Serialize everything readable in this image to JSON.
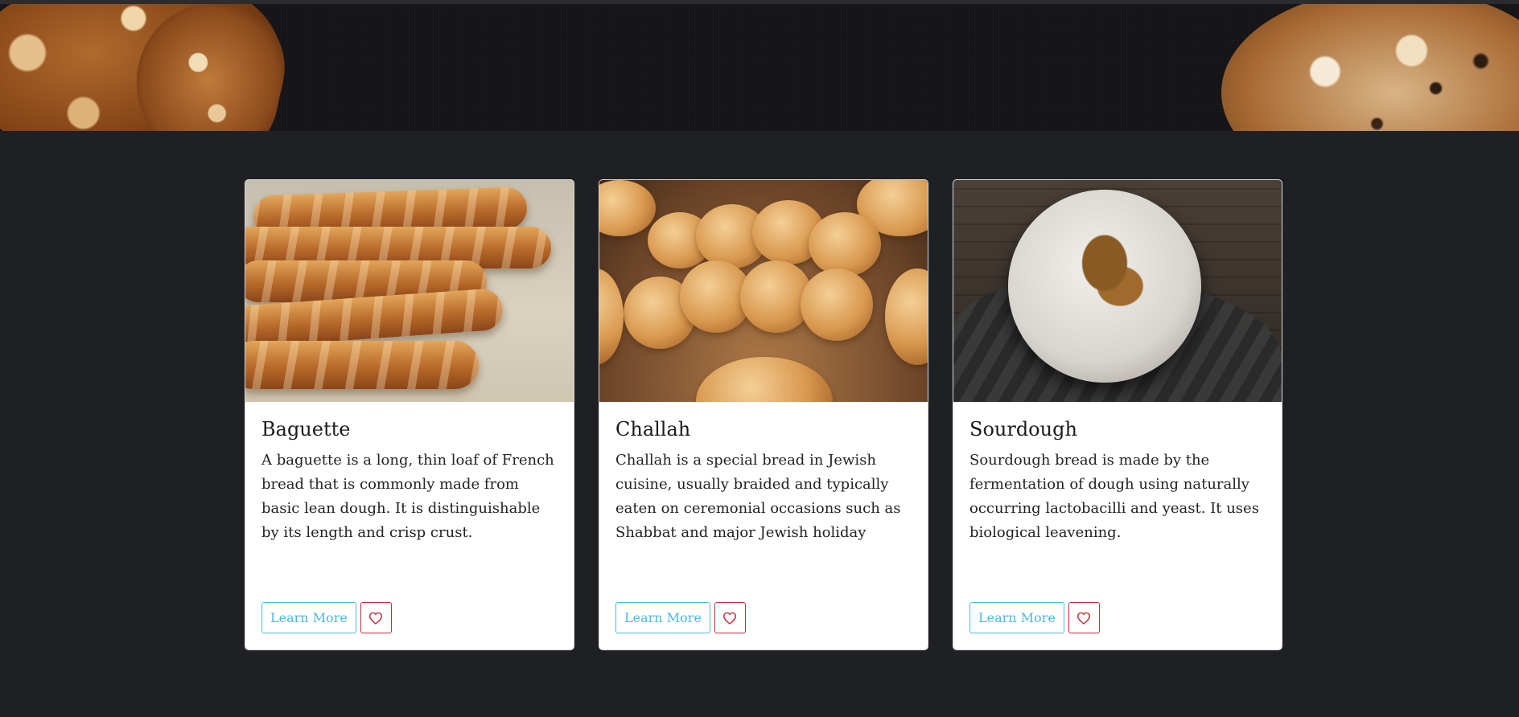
{
  "hero": {
    "image_alt": "bread-banner"
  },
  "cards": [
    {
      "title": "Baguette",
      "description": "A baguette is a long, thin loaf of French bread that is commonly made from basic lean dough. It is distinguishable by its length and crisp crust.",
      "learn_more_label": "Learn More",
      "favorite_icon": "heart-outline-icon"
    },
    {
      "title": "Challah",
      "description": "Challah is a special bread in Jewish cuisine, usually braided and typically eaten on ceremonial occasions such as Shabbat and major Jewish holiday",
      "learn_more_label": "Learn More",
      "favorite_icon": "heart-outline-icon"
    },
    {
      "title": "Sourdough",
      "description": "Sourdough bread is made by the fermentation of dough using naturally occurring lactobacilli and yeast. It uses biological leavening.",
      "learn_more_label": "Learn More",
      "favorite_icon": "heart-outline-icon"
    }
  ],
  "colors": {
    "background": "#1f2024",
    "learn_more": "#4fb8de",
    "favorite": "#c62a3a"
  }
}
